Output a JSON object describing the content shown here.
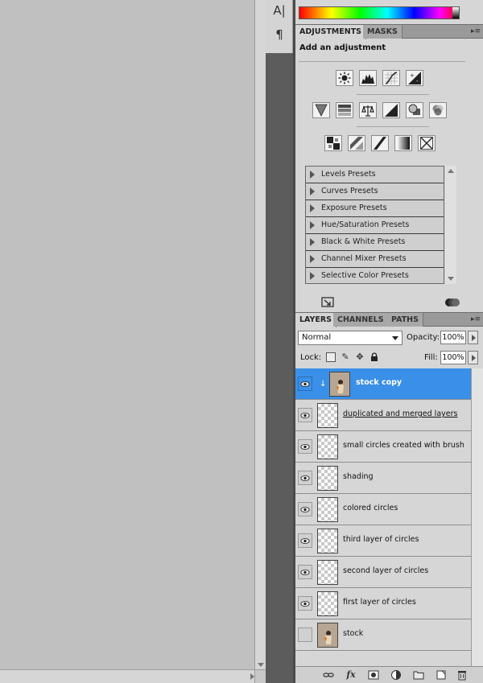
{
  "tools": {
    "type_icon": "type-tool-icon",
    "type_glyph": "A|",
    "paragraph_icon": "paragraph-icon",
    "paragraph_glyph": "¶"
  },
  "adjustments": {
    "tabs": [
      {
        "label": "ADJUSTMENTS",
        "active": true
      },
      {
        "label": "MASKS",
        "active": false
      }
    ],
    "title": "Add an adjustment",
    "icons_row1": [
      "brightness-contrast-icon",
      "levels-icon",
      "curves-icon",
      "exposure-icon"
    ],
    "icons_row2": [
      "vibrance-icon",
      "hue-saturation-icon",
      "color-balance-icon",
      "black-white-icon",
      "photo-filter-icon",
      "channel-mixer-icon"
    ],
    "icons_row3": [
      "invert-icon",
      "posterize-icon",
      "threshold-icon",
      "gradient-map-icon",
      "selective-color-icon"
    ],
    "presets": [
      "Levels Presets",
      "Curves Presets",
      "Exposure Presets",
      "Hue/Saturation Presets",
      "Black & White Presets",
      "Channel Mixer Presets",
      "Selective Color Presets"
    ]
  },
  "layers": {
    "tabs": [
      {
        "label": "LAYERS",
        "active": true
      },
      {
        "label": "CHANNELS",
        "active": false
      },
      {
        "label": "PATHS",
        "active": false
      }
    ],
    "blend_mode": "Normal",
    "opacity_label": "Opacity:",
    "opacity_value": "100%",
    "lock_label": "Lock:",
    "fill_label": "Fill:",
    "fill_value": "100%",
    "items": [
      {
        "name": "stock copy",
        "visible": true,
        "selected": true,
        "thumb": "photo",
        "clipped": true
      },
      {
        "name": "duplicated and merged layers",
        "visible": true,
        "selected": false,
        "thumb": "checker",
        "underline": true
      },
      {
        "name": "small circles created with brush",
        "visible": true,
        "selected": false,
        "thumb": "checker"
      },
      {
        "name": "shading",
        "visible": true,
        "selected": false,
        "thumb": "checker"
      },
      {
        "name": "colored circles",
        "visible": true,
        "selected": false,
        "thumb": "checker"
      },
      {
        "name": "third layer of circles",
        "visible": true,
        "selected": false,
        "thumb": "checker"
      },
      {
        "name": "second layer of circles",
        "visible": true,
        "selected": false,
        "thumb": "checker"
      },
      {
        "name": "first layer of circles",
        "visible": true,
        "selected": false,
        "thumb": "checker"
      },
      {
        "name": "stock",
        "visible": false,
        "selected": false,
        "thumb": "photo"
      }
    ],
    "footer_icons": [
      "link-layers-icon",
      "layer-style-icon",
      "add-mask-icon",
      "new-adjustment-layer-icon",
      "new-group-icon",
      "new-layer-icon",
      "delete-layer-icon"
    ],
    "footer_fx": "fx"
  },
  "colors": {
    "selected_row": "#3a8fe8",
    "panel_bg": "#d6d6d6",
    "canvas_bg": "#c0c0c0"
  }
}
